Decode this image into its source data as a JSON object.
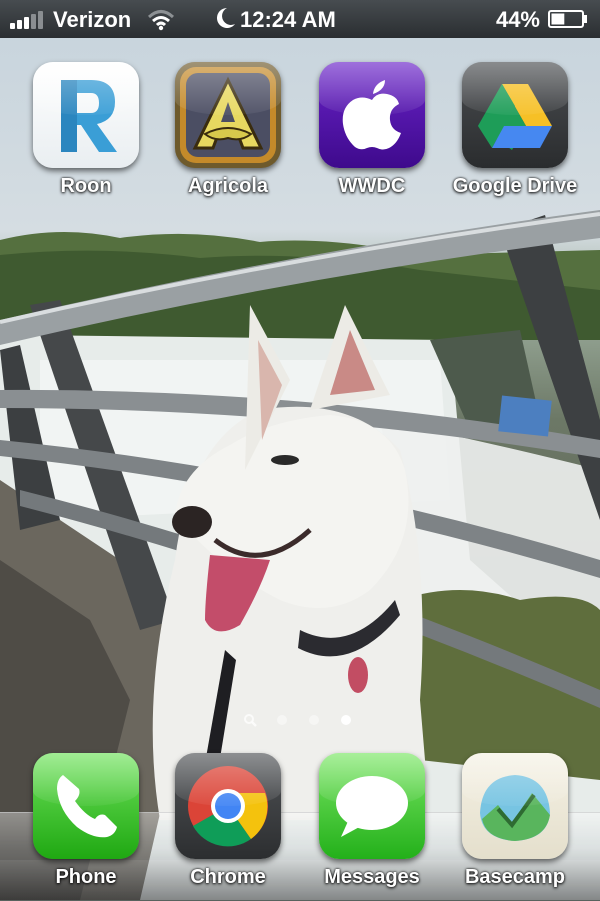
{
  "status_bar": {
    "carrier": "Verizon",
    "time": "12:24 AM",
    "battery_percent": "44%",
    "battery_level": 0.44,
    "signal_bars_active": 3,
    "icons": [
      "signal-bars-icon",
      "wifi-icon",
      "do-not-disturb-moon-icon",
      "battery-icon"
    ]
  },
  "home_apps": [
    {
      "label": "Roon",
      "icon": "roon-icon"
    },
    {
      "label": "Agricola",
      "icon": "agricola-icon"
    },
    {
      "label": "WWDC",
      "icon": "apple-logo-icon"
    },
    {
      "label": "Google Drive",
      "icon": "google-drive-icon"
    }
  ],
  "page_indicator": {
    "pages": 3,
    "current_page": 3,
    "has_spotlight": true
  },
  "dock_apps": [
    {
      "label": "Phone",
      "icon": "phone-icon"
    },
    {
      "label": "Chrome",
      "icon": "chrome-icon"
    },
    {
      "label": "Messages",
      "icon": "messages-icon"
    },
    {
      "label": "Basecamp",
      "icon": "basecamp-icon"
    }
  ],
  "colors": {
    "wwdc_purple": "#4b0fa0",
    "phone_green": "#2fbf1e",
    "messages_green": "#3cc42a",
    "drive_yellow": "#f6c026",
    "drive_green": "#1e9d58",
    "drive_blue": "#4688f1"
  }
}
